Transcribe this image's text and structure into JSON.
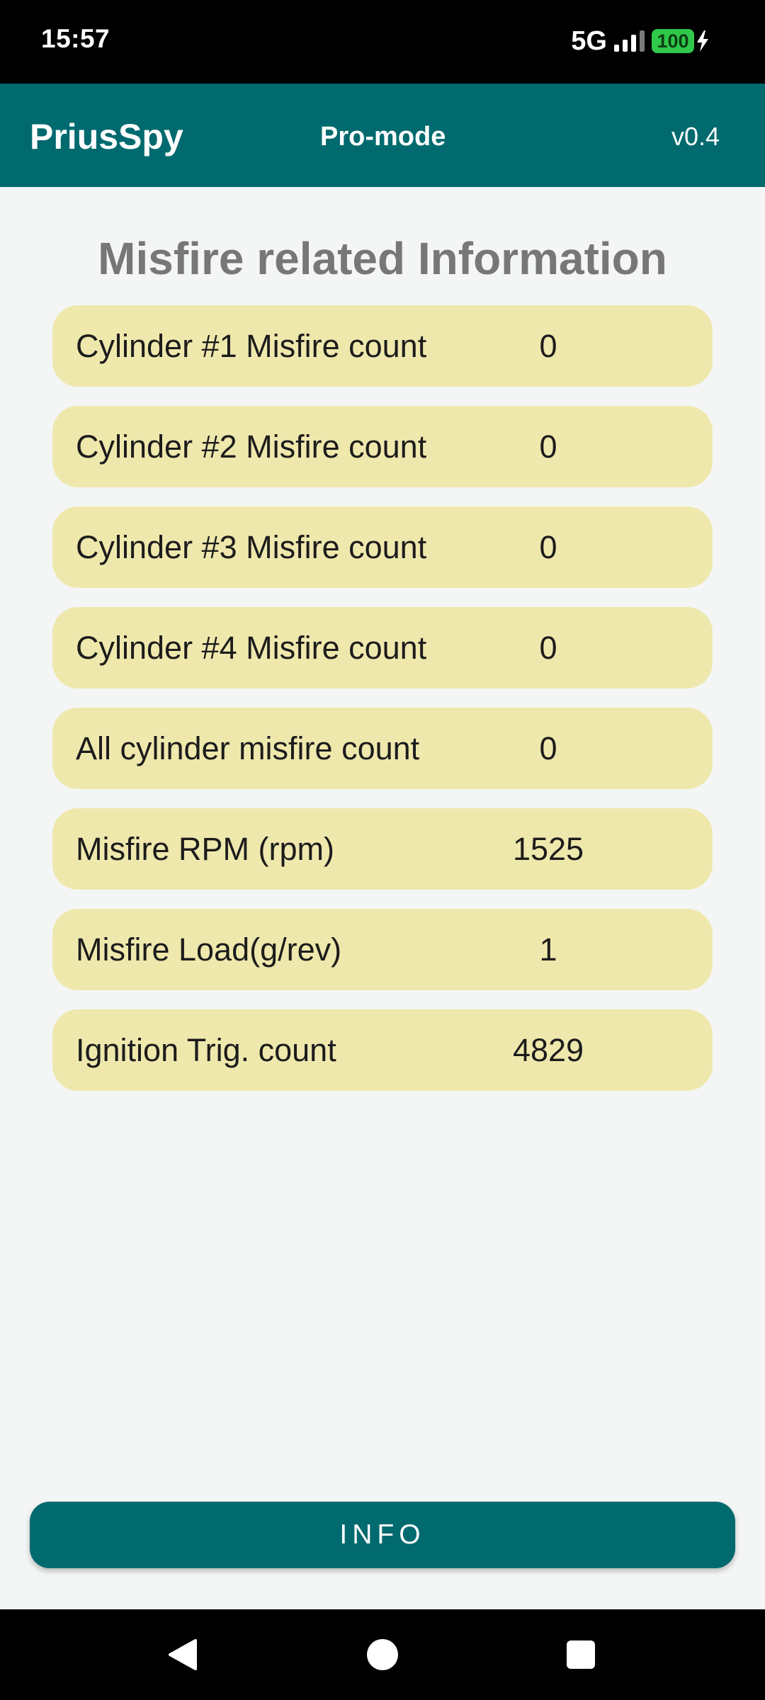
{
  "status_bar": {
    "time": "15:57",
    "network": "5G",
    "battery_level": "100",
    "icons": [
      "signal-icon",
      "battery-icon",
      "charging-bolt-icon"
    ]
  },
  "app_bar": {
    "title": "PriusSpy",
    "mode": "Pro-mode",
    "version": "v0.4",
    "color": "#006a6f"
  },
  "main": {
    "heading": "Misfire related Information",
    "rows": [
      {
        "label": "Cylinder #1 Misfire count",
        "value": "0"
      },
      {
        "label": "Cylinder #2 Misfire count",
        "value": "0"
      },
      {
        "label": "Cylinder #3 Misfire count",
        "value": "0"
      },
      {
        "label": "Cylinder #4 Misfire count",
        "value": "0"
      },
      {
        "label": "All cylinder misfire count",
        "value": "0"
      },
      {
        "label": "Misfire RPM (rpm)",
        "value": "1525"
      },
      {
        "label": "Misfire Load(g/rev)",
        "value": "1"
      },
      {
        "label": "Ignition Trig. count",
        "value": "4829"
      }
    ],
    "row_color": "#efe8ad"
  },
  "info_button": {
    "label": "INFO"
  },
  "nav_bar": {
    "icons": [
      "back-icon",
      "home-icon",
      "recents-icon"
    ]
  }
}
